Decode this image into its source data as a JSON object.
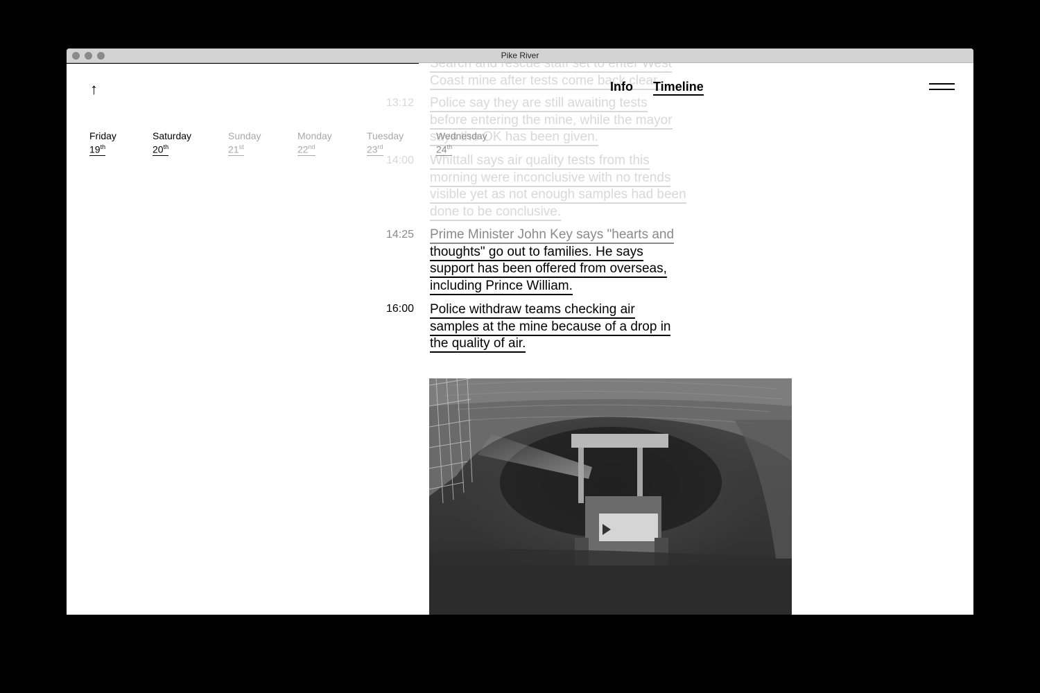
{
  "window": {
    "title": "Pike River"
  },
  "nav": {
    "info": "Info",
    "timeline": "Timeline"
  },
  "days": [
    {
      "name": "Friday",
      "num": "19",
      "suffix": "th"
    },
    {
      "name": "Saturday",
      "num": "20",
      "suffix": "th"
    },
    {
      "name": "Sunday",
      "num": "21",
      "suffix": "st"
    },
    {
      "name": "Monday",
      "num": "22",
      "suffix": "nd"
    },
    {
      "name": "Tuesday",
      "num": "23",
      "suffix": "rd"
    },
    {
      "name": "Wednesday",
      "num": "24",
      "suffix": "th"
    }
  ],
  "entries": [
    {
      "time": "",
      "lines": [
        "Search and rescue staff set to enter West",
        "Coast mine after tests come back clear."
      ]
    },
    {
      "time": "13:12",
      "lines": [
        "Police say they are still awaiting tests",
        "before entering the mine, while the mayor",
        "says the OK has been given."
      ]
    },
    {
      "time": "14:00",
      "lines": [
        "Whittall says air quality tests from this",
        "morning were inconclusive with no trends",
        "visible yet as not enough samples had been",
        "done to be conclusive."
      ]
    },
    {
      "time": "14:25",
      "lines": [
        "Prime Minister John Key says \"hearts and",
        "thoughts\" go out to families. He says",
        "support has been offered from overseas,",
        "including Prince William."
      ]
    },
    {
      "time": "16:00",
      "lines": [
        "Police withdraw teams checking air",
        "samples at the mine because of a drop in",
        "the quality of air."
      ]
    }
  ],
  "colors": {
    "faded": "#d8d8d8",
    "mid": "#8a8a8a",
    "text": "#000000"
  }
}
